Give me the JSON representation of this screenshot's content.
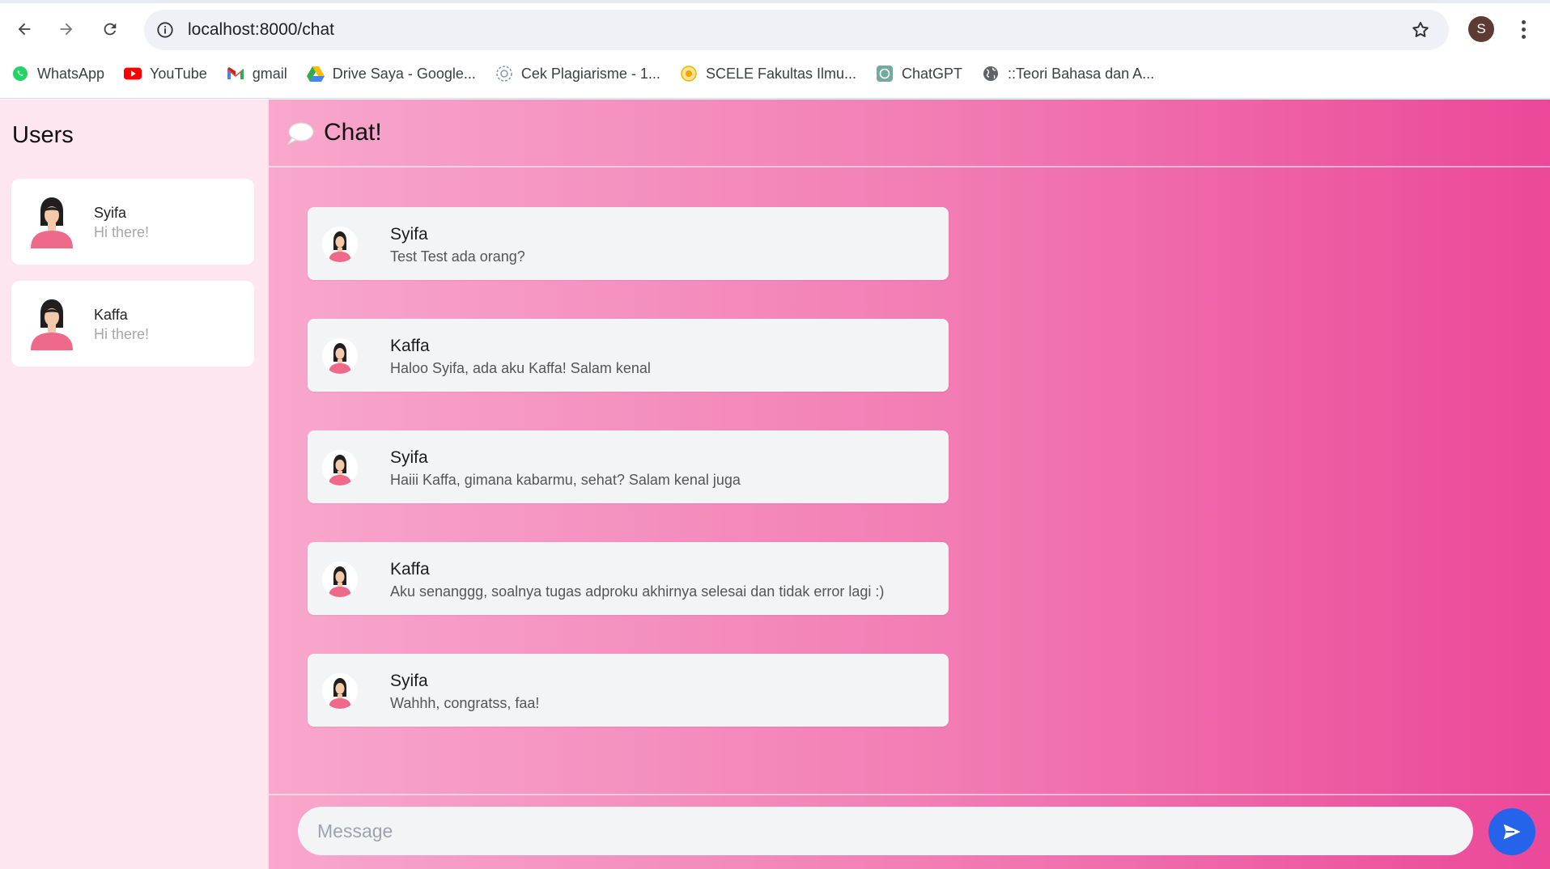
{
  "browser": {
    "url": "localhost:8000/chat",
    "profile_initial": "S",
    "bookmarks": [
      {
        "label": "WhatsApp",
        "icon": "whatsapp-icon"
      },
      {
        "label": "YouTube",
        "icon": "youtube-icon"
      },
      {
        "label": "gmail",
        "icon": "gmail-icon"
      },
      {
        "label": "Drive Saya - Google...",
        "icon": "drive-icon"
      },
      {
        "label": "Cek Plagiarisme - 1...",
        "icon": "plagiarism-icon"
      },
      {
        "label": "SCELE Fakultas Ilmu...",
        "icon": "scele-icon"
      },
      {
        "label": "ChatGPT",
        "icon": "chatgpt-icon"
      },
      {
        "label": "::Teori Bahasa dan A...",
        "icon": "globe-icon"
      }
    ]
  },
  "sidebar": {
    "title": "Users",
    "users": [
      {
        "name": "Syifa",
        "preview": "Hi there!"
      },
      {
        "name": "Kaffa",
        "preview": "Hi there!"
      }
    ]
  },
  "chat": {
    "title": "Chat!",
    "messages": [
      {
        "sender": "Syifa",
        "text": "Test Test ada orang?"
      },
      {
        "sender": "Kaffa",
        "text": "Haloo Syifa, ada aku Kaffa! Salam kenal"
      },
      {
        "sender": "Syifa",
        "text": "Haiii Kaffa, gimana kabarmu, sehat? Salam kenal juga"
      },
      {
        "sender": "Kaffa",
        "text": "Aku senanggg, soalnya tugas adproku akhirnya selesai dan tidak error lagi :)"
      },
      {
        "sender": "Syifa",
        "text": "Wahhh, congratss, faa!"
      }
    ],
    "composer": {
      "placeholder": "Message",
      "value": ""
    }
  },
  "colors": {
    "sidebar_bg": "#fde6ef",
    "gradient_start": "#f8a7cd",
    "gradient_end": "#eb4899",
    "send_button": "#2563eb"
  }
}
